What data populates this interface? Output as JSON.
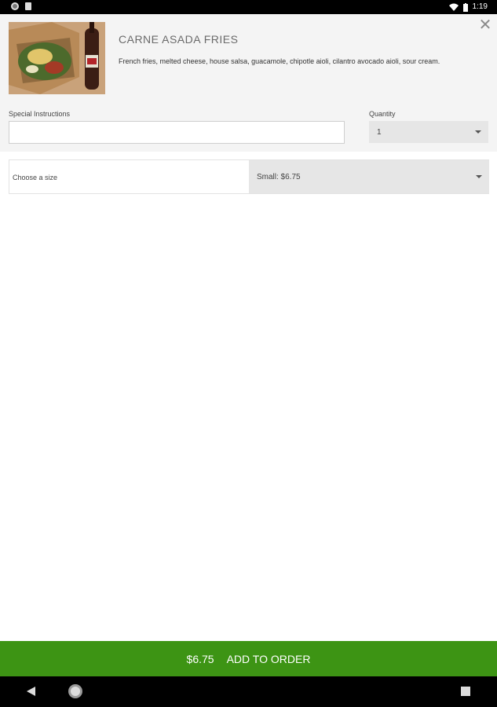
{
  "status_bar": {
    "time": "1:19"
  },
  "product": {
    "title": "CARNE ASADA FRIES",
    "description": "French fries, melted cheese, house salsa, guacamole, chipotle aioli, cilantro avocado aioli, sour cream."
  },
  "form": {
    "special_instructions_label": "Special Instructions",
    "special_instructions_value": "",
    "quantity_label": "Quantity",
    "quantity_value": "1",
    "size_label": "Choose a size",
    "size_value": "Small: $6.75"
  },
  "footer": {
    "price": "$6.75",
    "action_label": "ADD TO ORDER"
  },
  "colors": {
    "accent_green": "#3d9414",
    "panel_bg": "#f4f4f4"
  },
  "icons": {
    "close": "close-icon",
    "dropdown": "chevron-down-icon",
    "nav_back": "back-icon",
    "nav_home": "home-icon",
    "nav_recents": "recents-icon"
  }
}
